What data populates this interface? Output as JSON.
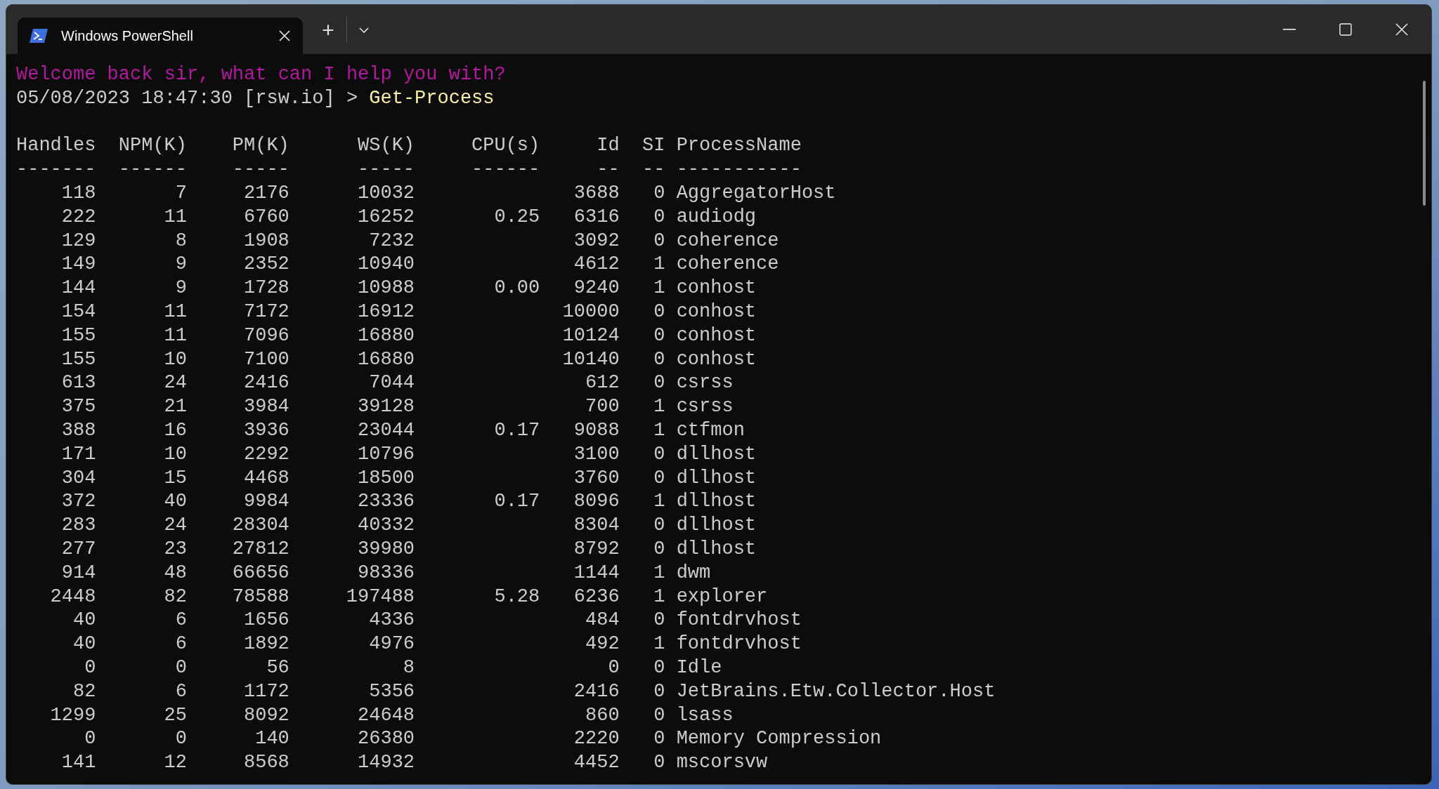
{
  "window": {
    "tabs": [
      {
        "title": "Windows PowerShell",
        "selected": true
      }
    ],
    "new_tab": "+"
  },
  "terminal": {
    "greeting": "Welcome back sir, what can I help you with?",
    "prompt": "05/08/2023 18:47:30 [rsw.io] >",
    "command": "Get-Process",
    "columns": [
      {
        "label": "Handles",
        "rule": "-------"
      },
      {
        "label": "NPM(K)",
        "rule": "------"
      },
      {
        "label": "PM(K)",
        "rule": "-----"
      },
      {
        "label": "WS(K)",
        "rule": "-----"
      },
      {
        "label": "CPU(s)",
        "rule": "------"
      },
      {
        "label": "Id",
        "rule": "--"
      },
      {
        "label": "SI",
        "rule": "--"
      },
      {
        "label": "ProcessName",
        "rule": "-----------"
      }
    ],
    "rows": [
      {
        "handles": "118",
        "npm": "7",
        "pm": "2176",
        "ws": "10032",
        "id": "3688",
        "si": "0",
        "name": "AggregatorHost"
      },
      {
        "handles": "222",
        "npm": "11",
        "pm": "6760",
        "ws": "16252",
        "cpu": "0.25",
        "id": "6316",
        "si": "0",
        "name": "audiodg"
      },
      {
        "handles": "129",
        "npm": "8",
        "pm": "1908",
        "ws": "7232",
        "id": "3092",
        "si": "0",
        "name": "coherence"
      },
      {
        "handles": "149",
        "npm": "9",
        "pm": "2352",
        "ws": "10940",
        "id": "4612",
        "si": "1",
        "name": "coherence"
      },
      {
        "handles": "144",
        "npm": "9",
        "pm": "1728",
        "ws": "10988",
        "cpu": "0.00",
        "id": "9240",
        "si": "1",
        "name": "conhost"
      },
      {
        "handles": "154",
        "npm": "11",
        "pm": "7172",
        "ws": "16912",
        "id": "10000",
        "si": "0",
        "name": "conhost"
      },
      {
        "handles": "155",
        "npm": "11",
        "pm": "7096",
        "ws": "16880",
        "id": "10124",
        "si": "0",
        "name": "conhost"
      },
      {
        "handles": "155",
        "npm": "10",
        "pm": "7100",
        "ws": "16880",
        "id": "10140",
        "si": "0",
        "name": "conhost"
      },
      {
        "handles": "613",
        "npm": "24",
        "pm": "2416",
        "ws": "7044",
        "id": "612",
        "si": "0",
        "name": "csrss"
      },
      {
        "handles": "375",
        "npm": "21",
        "pm": "3984",
        "ws": "39128",
        "id": "700",
        "si": "1",
        "name": "csrss"
      },
      {
        "handles": "388",
        "npm": "16",
        "pm": "3936",
        "ws": "23044",
        "cpu": "0.17",
        "id": "9088",
        "si": "1",
        "name": "ctfmon"
      },
      {
        "handles": "171",
        "npm": "10",
        "pm": "2292",
        "ws": "10796",
        "id": "3100",
        "si": "0",
        "name": "dllhost"
      },
      {
        "handles": "304",
        "npm": "15",
        "pm": "4468",
        "ws": "18500",
        "id": "3760",
        "si": "0",
        "name": "dllhost"
      },
      {
        "handles": "372",
        "npm": "40",
        "pm": "9984",
        "ws": "23336",
        "cpu": "0.17",
        "id": "8096",
        "si": "1",
        "name": "dllhost"
      },
      {
        "handles": "283",
        "npm": "24",
        "pm": "28304",
        "ws": "40332",
        "id": "8304",
        "si": "0",
        "name": "dllhost"
      },
      {
        "handles": "277",
        "npm": "23",
        "pm": "27812",
        "ws": "39980",
        "id": "8792",
        "si": "0",
        "name": "dllhost"
      },
      {
        "handles": "914",
        "npm": "48",
        "pm": "66656",
        "ws": "98336",
        "id": "1144",
        "si": "1",
        "name": "dwm"
      },
      {
        "handles": "2448",
        "npm": "82",
        "pm": "78588",
        "ws": "197488",
        "cpu": "5.28",
        "id": "6236",
        "si": "1",
        "name": "explorer"
      },
      {
        "handles": "40",
        "npm": "6",
        "pm": "1656",
        "ws": "4336",
        "id": "484",
        "si": "0",
        "name": "fontdrvhost"
      },
      {
        "handles": "40",
        "npm": "6",
        "pm": "1892",
        "ws": "4976",
        "id": "492",
        "si": "1",
        "name": "fontdrvhost"
      },
      {
        "handles": "0",
        "npm": "0",
        "pm": "56",
        "ws": "8",
        "id": "0",
        "si": "0",
        "name": "Idle"
      },
      {
        "handles": "82",
        "npm": "6",
        "pm": "1172",
        "ws": "5356",
        "id": "2416",
        "si": "0",
        "name": "JetBrains.Etw.Collector.Host"
      },
      {
        "handles": "1299",
        "npm": "25",
        "pm": "8092",
        "ws": "24648",
        "id": "860",
        "si": "0",
        "name": "lsass"
      },
      {
        "handles": "0",
        "npm": "0",
        "pm": "140",
        "ws": "26380",
        "id": "2220",
        "si": "0",
        "name": "Memory Compression"
      },
      {
        "handles": "141",
        "npm": "12",
        "pm": "8568",
        "ws": "14932",
        "id": "4452",
        "si": "0",
        "name": "mscorsvw"
      }
    ]
  }
}
